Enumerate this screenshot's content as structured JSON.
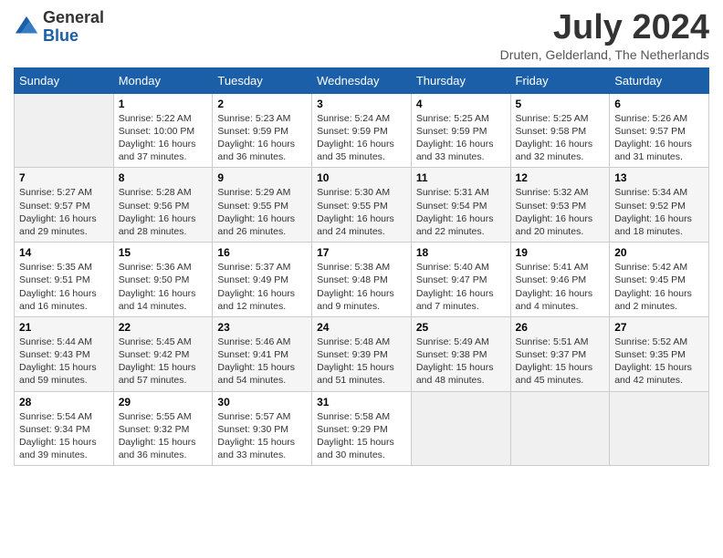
{
  "logo": {
    "general": "General",
    "blue": "Blue"
  },
  "title": "July 2024",
  "location": "Druten, Gelderland, The Netherlands",
  "days_of_week": [
    "Sunday",
    "Monday",
    "Tuesday",
    "Wednesday",
    "Thursday",
    "Friday",
    "Saturday"
  ],
  "weeks": [
    [
      {
        "day": "",
        "sunrise": "",
        "sunset": "",
        "daylight": ""
      },
      {
        "day": "1",
        "sunrise": "Sunrise: 5:22 AM",
        "sunset": "Sunset: 10:00 PM",
        "daylight": "Daylight: 16 hours and 37 minutes."
      },
      {
        "day": "2",
        "sunrise": "Sunrise: 5:23 AM",
        "sunset": "Sunset: 9:59 PM",
        "daylight": "Daylight: 16 hours and 36 minutes."
      },
      {
        "day": "3",
        "sunrise": "Sunrise: 5:24 AM",
        "sunset": "Sunset: 9:59 PM",
        "daylight": "Daylight: 16 hours and 35 minutes."
      },
      {
        "day": "4",
        "sunrise": "Sunrise: 5:25 AM",
        "sunset": "Sunset: 9:59 PM",
        "daylight": "Daylight: 16 hours and 33 minutes."
      },
      {
        "day": "5",
        "sunrise": "Sunrise: 5:25 AM",
        "sunset": "Sunset: 9:58 PM",
        "daylight": "Daylight: 16 hours and 32 minutes."
      },
      {
        "day": "6",
        "sunrise": "Sunrise: 5:26 AM",
        "sunset": "Sunset: 9:57 PM",
        "daylight": "Daylight: 16 hours and 31 minutes."
      }
    ],
    [
      {
        "day": "7",
        "sunrise": "Sunrise: 5:27 AM",
        "sunset": "Sunset: 9:57 PM",
        "daylight": "Daylight: 16 hours and 29 minutes."
      },
      {
        "day": "8",
        "sunrise": "Sunrise: 5:28 AM",
        "sunset": "Sunset: 9:56 PM",
        "daylight": "Daylight: 16 hours and 28 minutes."
      },
      {
        "day": "9",
        "sunrise": "Sunrise: 5:29 AM",
        "sunset": "Sunset: 9:55 PM",
        "daylight": "Daylight: 16 hours and 26 minutes."
      },
      {
        "day": "10",
        "sunrise": "Sunrise: 5:30 AM",
        "sunset": "Sunset: 9:55 PM",
        "daylight": "Daylight: 16 hours and 24 minutes."
      },
      {
        "day": "11",
        "sunrise": "Sunrise: 5:31 AM",
        "sunset": "Sunset: 9:54 PM",
        "daylight": "Daylight: 16 hours and 22 minutes."
      },
      {
        "day": "12",
        "sunrise": "Sunrise: 5:32 AM",
        "sunset": "Sunset: 9:53 PM",
        "daylight": "Daylight: 16 hours and 20 minutes."
      },
      {
        "day": "13",
        "sunrise": "Sunrise: 5:34 AM",
        "sunset": "Sunset: 9:52 PM",
        "daylight": "Daylight: 16 hours and 18 minutes."
      }
    ],
    [
      {
        "day": "14",
        "sunrise": "Sunrise: 5:35 AM",
        "sunset": "Sunset: 9:51 PM",
        "daylight": "Daylight: 16 hours and 16 minutes."
      },
      {
        "day": "15",
        "sunrise": "Sunrise: 5:36 AM",
        "sunset": "Sunset: 9:50 PM",
        "daylight": "Daylight: 16 hours and 14 minutes."
      },
      {
        "day": "16",
        "sunrise": "Sunrise: 5:37 AM",
        "sunset": "Sunset: 9:49 PM",
        "daylight": "Daylight: 16 hours and 12 minutes."
      },
      {
        "day": "17",
        "sunrise": "Sunrise: 5:38 AM",
        "sunset": "Sunset: 9:48 PM",
        "daylight": "Daylight: 16 hours and 9 minutes."
      },
      {
        "day": "18",
        "sunrise": "Sunrise: 5:40 AM",
        "sunset": "Sunset: 9:47 PM",
        "daylight": "Daylight: 16 hours and 7 minutes."
      },
      {
        "day": "19",
        "sunrise": "Sunrise: 5:41 AM",
        "sunset": "Sunset: 9:46 PM",
        "daylight": "Daylight: 16 hours and 4 minutes."
      },
      {
        "day": "20",
        "sunrise": "Sunrise: 5:42 AM",
        "sunset": "Sunset: 9:45 PM",
        "daylight": "Daylight: 16 hours and 2 minutes."
      }
    ],
    [
      {
        "day": "21",
        "sunrise": "Sunrise: 5:44 AM",
        "sunset": "Sunset: 9:43 PM",
        "daylight": "Daylight: 15 hours and 59 minutes."
      },
      {
        "day": "22",
        "sunrise": "Sunrise: 5:45 AM",
        "sunset": "Sunset: 9:42 PM",
        "daylight": "Daylight: 15 hours and 57 minutes."
      },
      {
        "day": "23",
        "sunrise": "Sunrise: 5:46 AM",
        "sunset": "Sunset: 9:41 PM",
        "daylight": "Daylight: 15 hours and 54 minutes."
      },
      {
        "day": "24",
        "sunrise": "Sunrise: 5:48 AM",
        "sunset": "Sunset: 9:39 PM",
        "daylight": "Daylight: 15 hours and 51 minutes."
      },
      {
        "day": "25",
        "sunrise": "Sunrise: 5:49 AM",
        "sunset": "Sunset: 9:38 PM",
        "daylight": "Daylight: 15 hours and 48 minutes."
      },
      {
        "day": "26",
        "sunrise": "Sunrise: 5:51 AM",
        "sunset": "Sunset: 9:37 PM",
        "daylight": "Daylight: 15 hours and 45 minutes."
      },
      {
        "day": "27",
        "sunrise": "Sunrise: 5:52 AM",
        "sunset": "Sunset: 9:35 PM",
        "daylight": "Daylight: 15 hours and 42 minutes."
      }
    ],
    [
      {
        "day": "28",
        "sunrise": "Sunrise: 5:54 AM",
        "sunset": "Sunset: 9:34 PM",
        "daylight": "Daylight: 15 hours and 39 minutes."
      },
      {
        "day": "29",
        "sunrise": "Sunrise: 5:55 AM",
        "sunset": "Sunset: 9:32 PM",
        "daylight": "Daylight: 15 hours and 36 minutes."
      },
      {
        "day": "30",
        "sunrise": "Sunrise: 5:57 AM",
        "sunset": "Sunset: 9:30 PM",
        "daylight": "Daylight: 15 hours and 33 minutes."
      },
      {
        "day": "31",
        "sunrise": "Sunrise: 5:58 AM",
        "sunset": "Sunset: 9:29 PM",
        "daylight": "Daylight: 15 hours and 30 minutes."
      },
      {
        "day": "",
        "sunrise": "",
        "sunset": "",
        "daylight": ""
      },
      {
        "day": "",
        "sunrise": "",
        "sunset": "",
        "daylight": ""
      },
      {
        "day": "",
        "sunrise": "",
        "sunset": "",
        "daylight": ""
      }
    ]
  ]
}
